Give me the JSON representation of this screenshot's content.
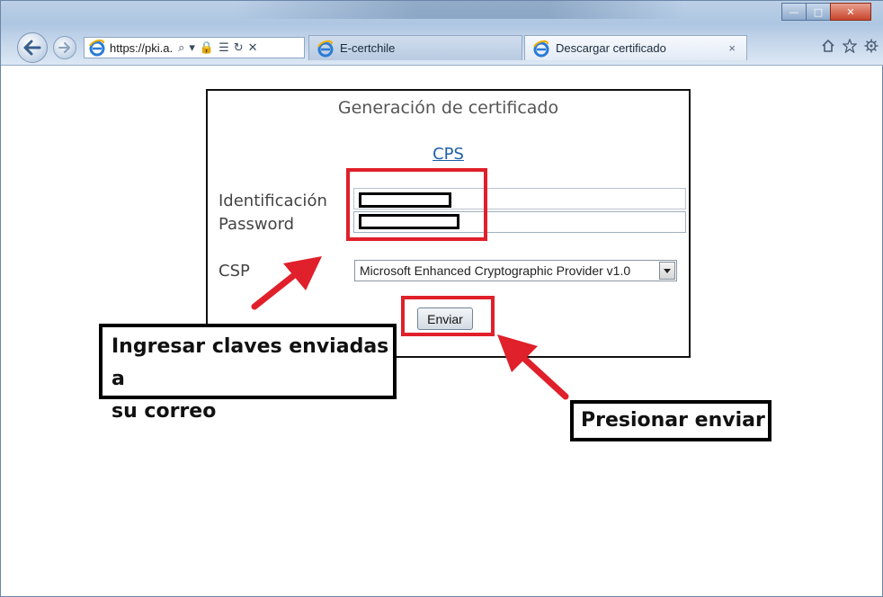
{
  "browser": {
    "address_url": "https://pki.a.",
    "address_tools": [
      "⌕",
      "▾",
      "🔒",
      "☰",
      "↻",
      "✕"
    ],
    "tabs": [
      {
        "label": "E-certchile",
        "active": false
      },
      {
        "label": "Descargar certificado",
        "active": true,
        "close": "×"
      }
    ],
    "window_controls": {
      "minimize": "—",
      "maximize": "□",
      "close": "✕"
    },
    "toolbar_icons": [
      "home-icon",
      "star-icon",
      "gear-icon"
    ]
  },
  "form": {
    "title": "Generación de certificado",
    "cps_link": "CPS",
    "identificacion_label": "Identificación",
    "password_label": "Password",
    "csp_label": "CSP",
    "csp_value": "Microsoft Enhanced Cryptographic Provider v1.0",
    "submit_label": "Enviar"
  },
  "annotations": {
    "callout_credentials": [
      "Ingresar claves enviadas a",
      "su correo"
    ],
    "callout_submit": "Presionar enviar",
    "highlight_color": "#e0202a"
  }
}
